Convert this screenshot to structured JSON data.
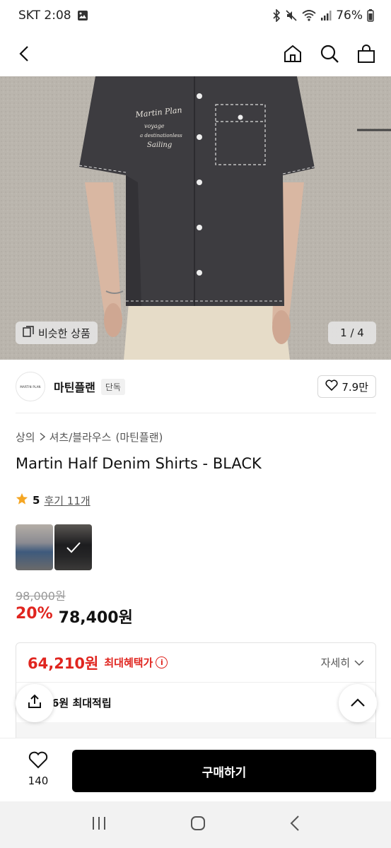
{
  "status": {
    "carrier_time": "SKT 2:08",
    "battery": "76%",
    "icons": [
      "gallery-icon",
      "bluetooth-icon",
      "mute-icon",
      "wifi-icon",
      "signal-icon",
      "battery-icon"
    ]
  },
  "header": {
    "back_icon": "back-arrow-icon",
    "home_icon": "home-icon",
    "search_icon": "search-icon",
    "bag_icon": "shopping-bag-icon"
  },
  "gallery": {
    "similar_label": "비슷한 상품",
    "pager": "1 / 4",
    "shirt_embroidery": [
      "Martin Plan",
      "voyage",
      "a destinationless",
      "Sailing"
    ]
  },
  "brand": {
    "logo_text": "MARTIN PLAN",
    "name": "마틴플랜",
    "badge": "단독",
    "likes": "7.9만"
  },
  "product": {
    "breadcrumb": [
      "상의",
      "셔츠/블라우스",
      "(마틴플랜)"
    ],
    "title": "Martin Half Denim Shirts - BLACK",
    "rating": "5",
    "reviews": "후기 11개",
    "original_price": "98,000원",
    "discount": "20%",
    "sale_price": "78,400원"
  },
  "benefit": {
    "max_price": "64,210원",
    "max_label": "최대혜택가",
    "detail_label": "자세히",
    "points_label": "6원 최대적립"
  },
  "bottom": {
    "wish_count": "140",
    "buy_label": "구매하기"
  },
  "colors": {
    "accent_red": "#e0251f",
    "buy_button": "#000000",
    "star": "#f5a623"
  }
}
